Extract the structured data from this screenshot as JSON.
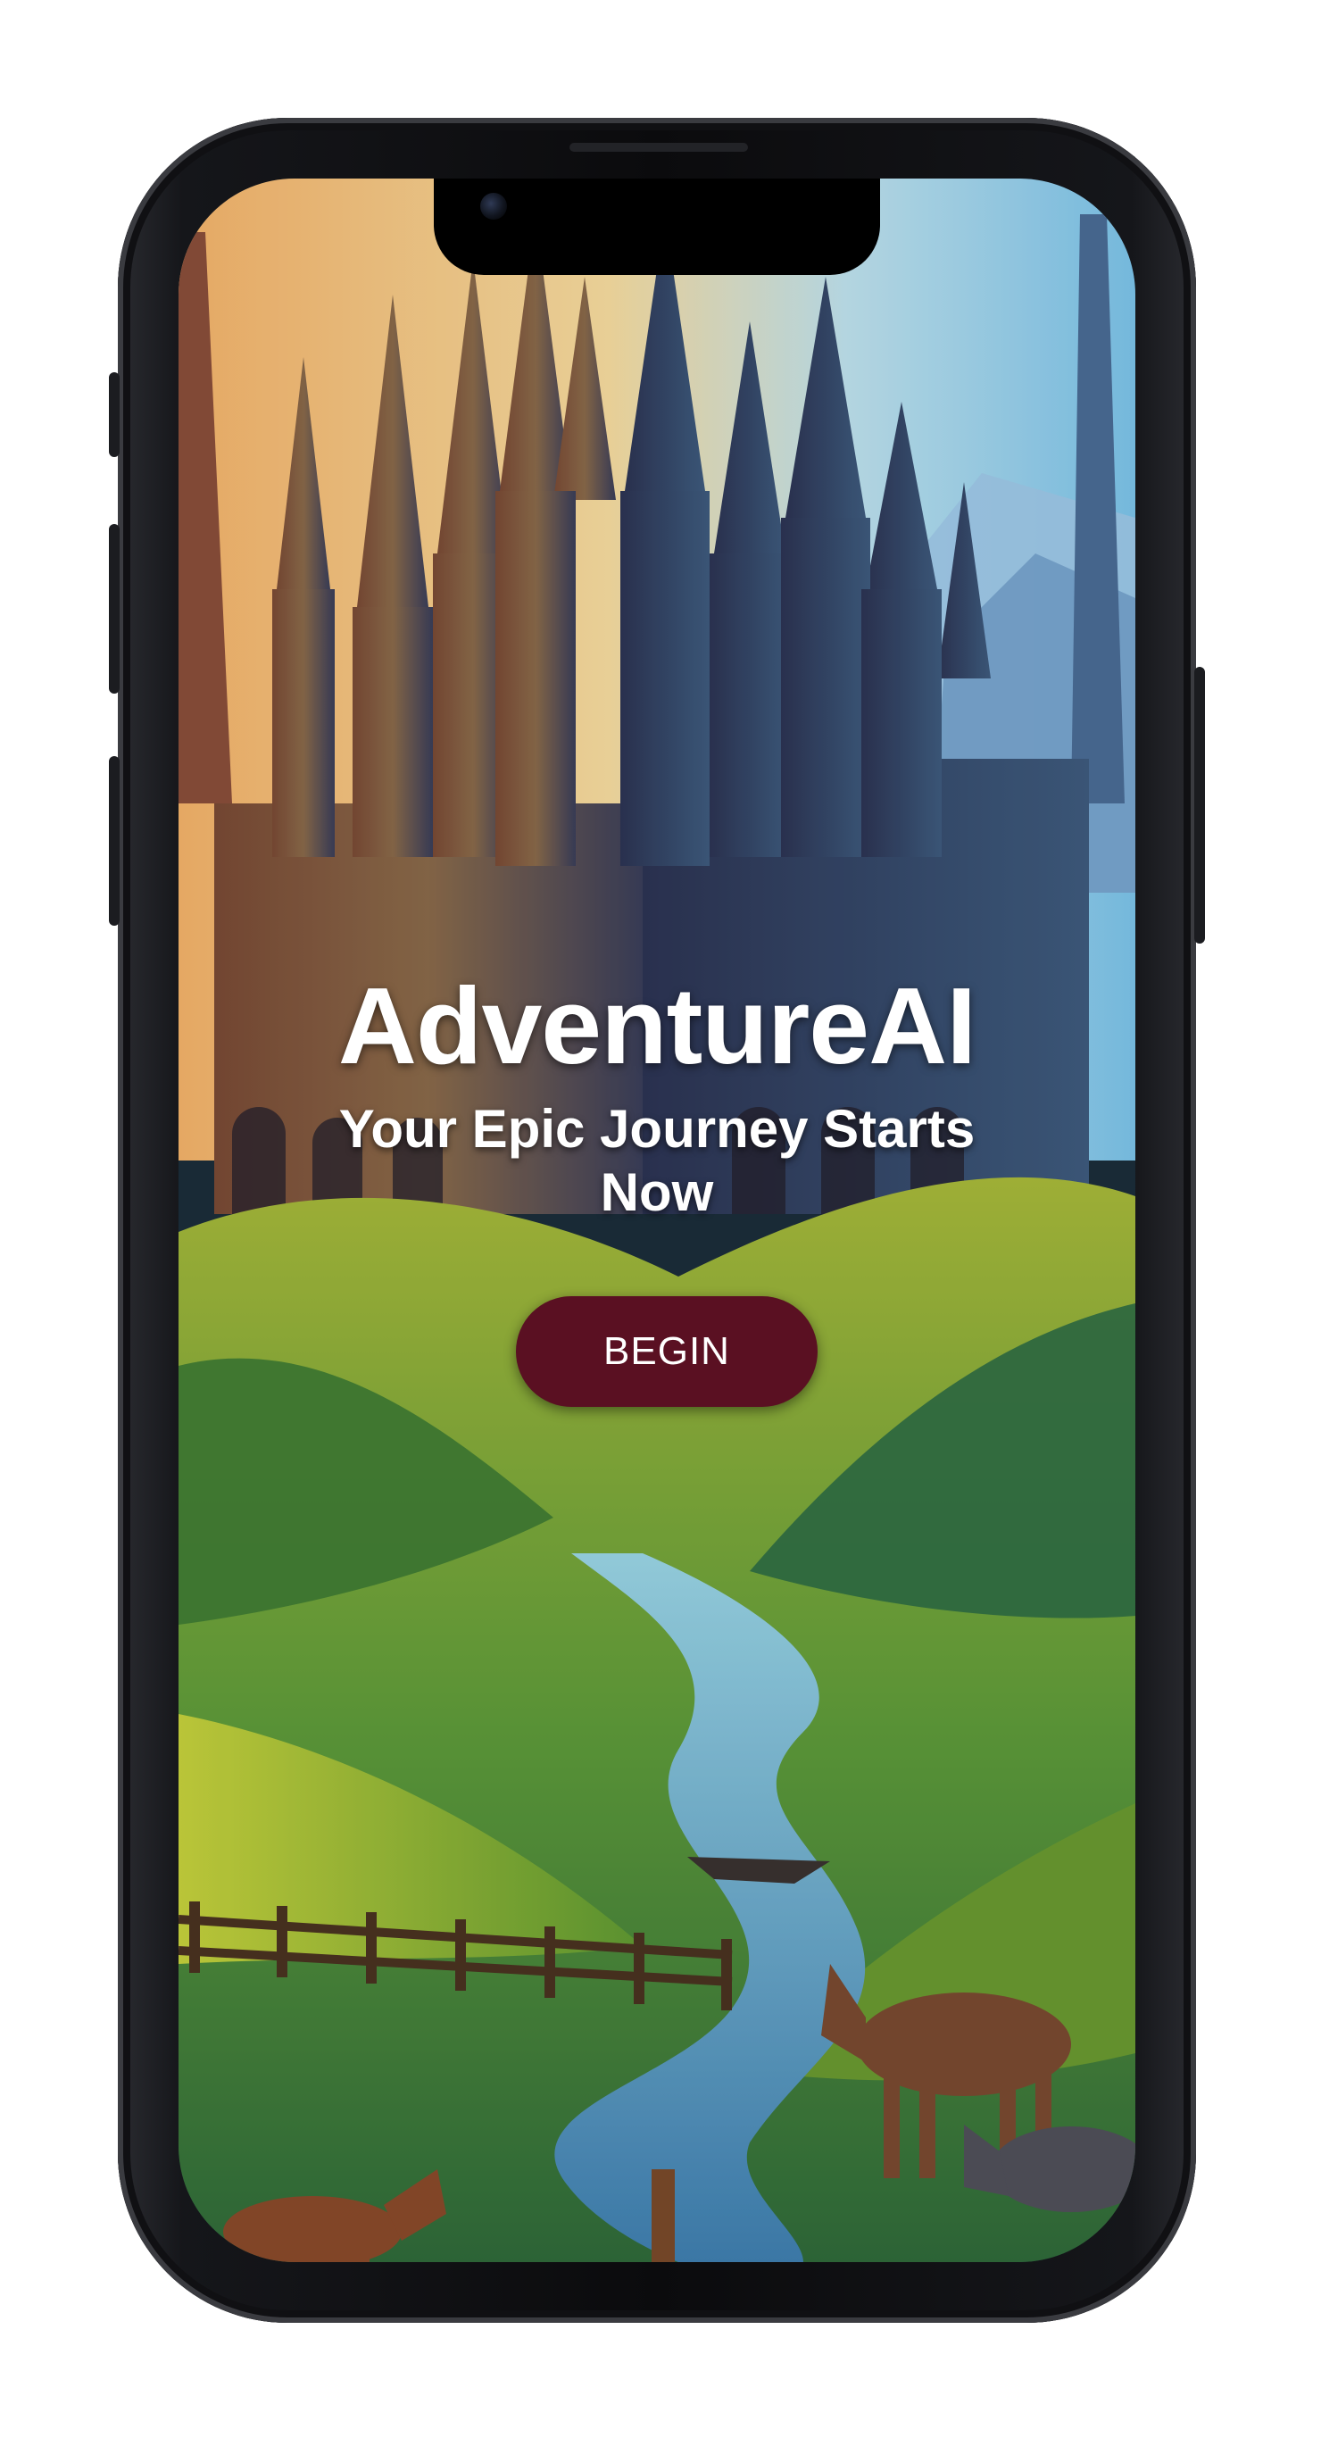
{
  "app": {
    "title": "AdventureAI",
    "tagline": "Your Epic Journey Starts Now",
    "cta_label": "BEGIN"
  },
  "colors": {
    "button_background": "#5a1022",
    "button_text": "#ffffff",
    "title_text": "#ffffff",
    "phone_frame": "#0b0b0d"
  },
  "icons": {
    "camera": "front-camera-icon"
  }
}
